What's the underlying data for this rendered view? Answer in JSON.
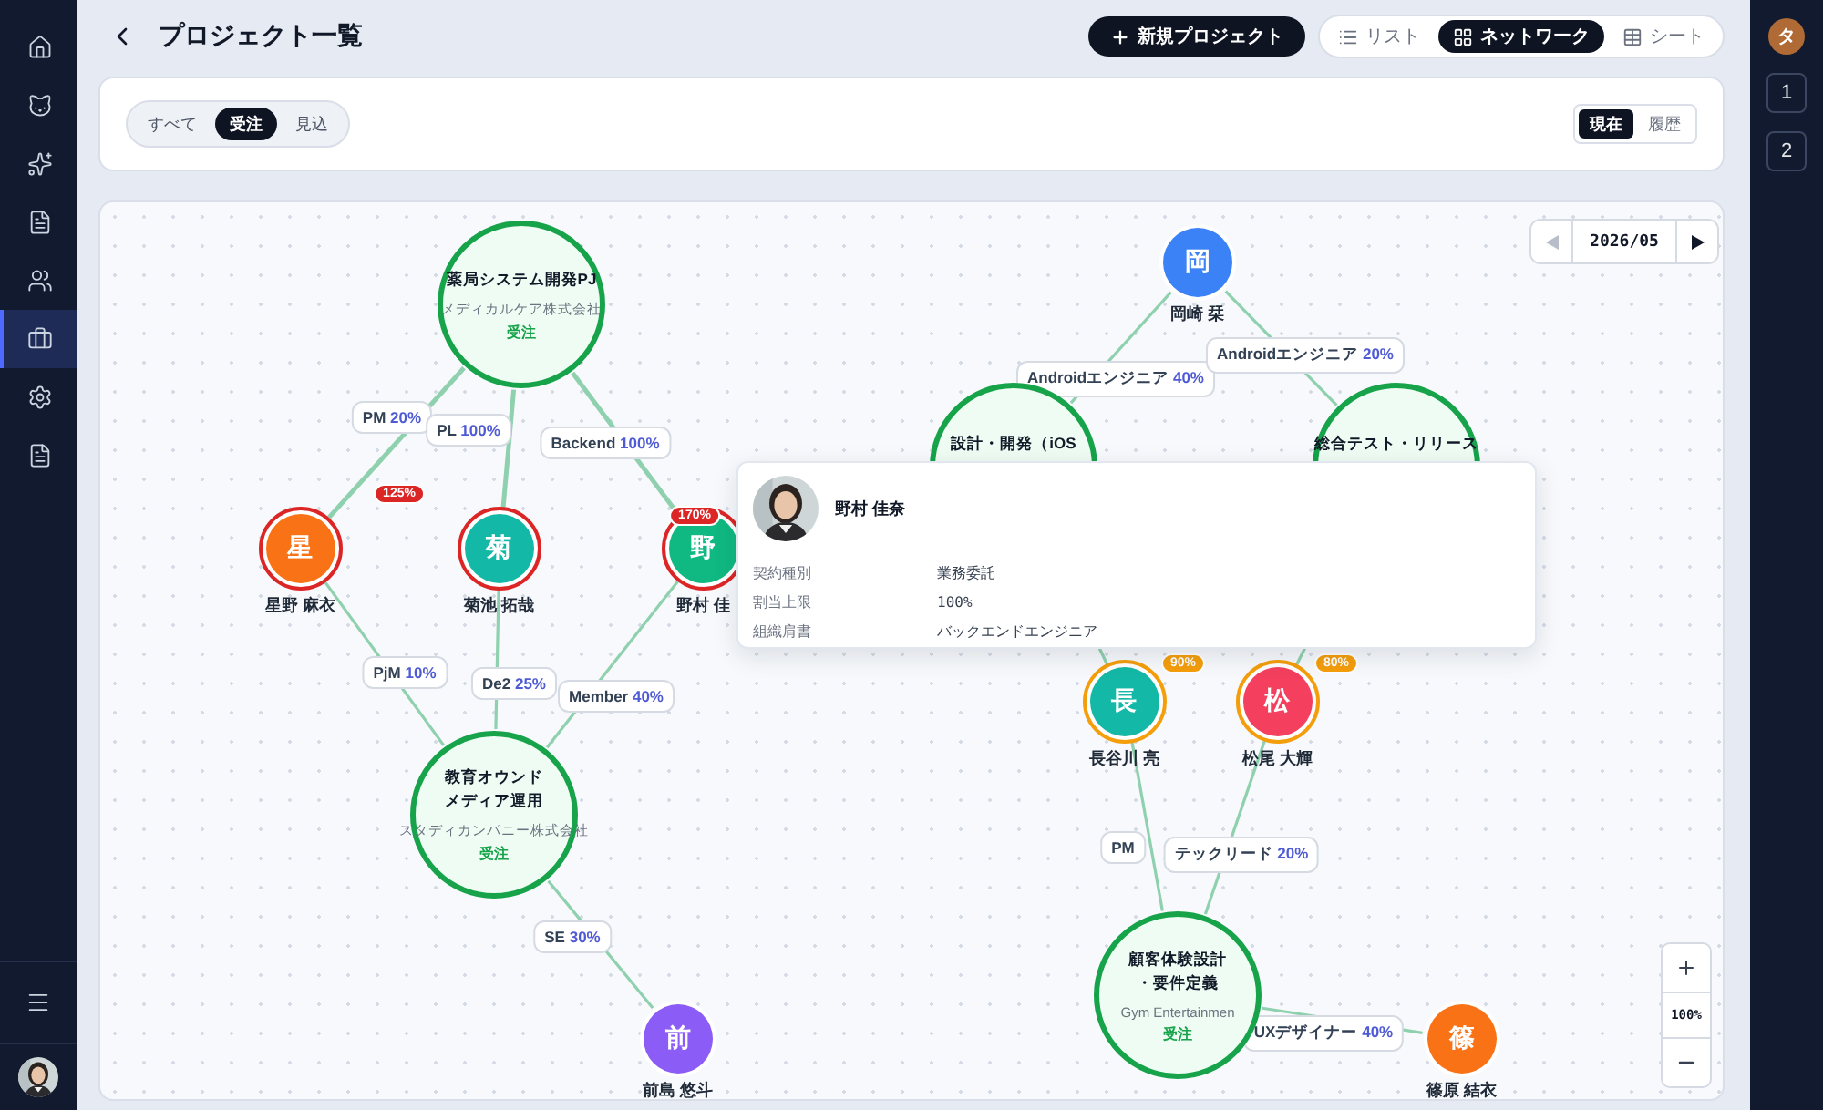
{
  "sidebar": {
    "items": [
      {
        "selected": false
      },
      {
        "selected": false
      },
      {
        "selected": false
      },
      {
        "selected": false
      },
      {
        "selected": false
      },
      {
        "selected": true
      },
      {
        "selected": false
      },
      {
        "selected": false
      }
    ]
  },
  "header": {
    "title": "プロジェクト一覧",
    "new_button": "新規プロジェクト",
    "views": [
      {
        "label": "リスト",
        "selected": false
      },
      {
        "label": "ネットワーク",
        "selected": true
      },
      {
        "label": "シート",
        "selected": false
      }
    ]
  },
  "filters": {
    "status_tabs": [
      {
        "label": "すべて",
        "selected": false
      },
      {
        "label": "受注",
        "selected": true
      },
      {
        "label": "見込",
        "selected": false
      }
    ],
    "time_tabs": [
      {
        "label": "現在",
        "selected": true
      },
      {
        "label": "履歴",
        "selected": false
      }
    ]
  },
  "network": {
    "month": "2026/05",
    "prev_disabled": true,
    "next_disabled": false,
    "projects": [
      {
        "title": [
          "薬局システム開発PJ"
        ],
        "client": "メディカルケア株式会社",
        "status": "受注"
      },
      {
        "title": [
          "設計・開発（iOS"
        ]
      },
      {
        "title": [
          "総合テスト・リリース"
        ]
      },
      {
        "title": [
          "教育オウンド",
          "メディア運用"
        ],
        "client": "スタディカンパニー株式会社",
        "status": "受注"
      },
      {
        "title": [
          "顧客体験設計",
          "・要件定義"
        ],
        "client": "Gym Entertainmen",
        "status": "受注"
      }
    ],
    "members": [
      {
        "initial": "星",
        "name": "星野 麻衣",
        "color": "#f97316",
        "overloaded": true,
        "warning": false,
        "load": "125%"
      },
      {
        "initial": "菊",
        "name": "菊池 拓哉",
        "color": "#14b8a6",
        "overloaded": true,
        "warning": false
      },
      {
        "initial": "野",
        "name": "野村 佳",
        "color": "#10b981",
        "overloaded": true,
        "warning": false,
        "load": "170%"
      },
      {
        "initial": "岡",
        "name": "岡崎 栞",
        "color": "#3b82f6",
        "overloaded": false,
        "warning": false
      },
      {
        "initial": "長",
        "name": "長谷川 亮",
        "color": "#14b8a6",
        "overloaded": false,
        "warning": true,
        "load": "90%"
      },
      {
        "initial": "松",
        "name": "松尾 大輝",
        "color": "#f43f5e",
        "overloaded": false,
        "warning": true,
        "load": "80%"
      },
      {
        "initial": "前",
        "name": "前島 悠斗",
        "color": "#8b5cf6",
        "overloaded": false,
        "warning": false
      },
      {
        "initial": "篠",
        "name": "篠原 結衣",
        "color": "#f97316",
        "overloaded": false,
        "warning": false
      }
    ],
    "assignments": [
      {
        "role": "PM",
        "percent": "20%"
      },
      {
        "role": "PL",
        "percent": "100%"
      },
      {
        "role": "Backend",
        "percent": "100%"
      },
      {
        "role": "Androidエンジニア",
        "percent": "40%"
      },
      {
        "role": "Androidエンジニア",
        "percent": "20%"
      },
      {
        "role": "PjM",
        "percent": "10%"
      },
      {
        "role": "De2",
        "percent": "25%"
      },
      {
        "role": "Member",
        "percent": "40%"
      },
      {
        "role": "SE",
        "percent": "30%"
      },
      {
        "role": "PM"
      },
      {
        "role": "テックリード",
        "percent": "20%"
      },
      {
        "role": "UXデザイナー",
        "percent": "40%"
      }
    ],
    "tooltip": {
      "name": "野村 佳奈",
      "rows": [
        {
          "label": "契約種別",
          "value": "業務委託"
        },
        {
          "label": "割当上限",
          "value": "100%"
        },
        {
          "label": "組織肩書",
          "value": "バックエンドエンジニア"
        }
      ]
    },
    "zoom": "100%"
  },
  "right_rail": {
    "avatar": "タ",
    "items": [
      {
        "label": "1"
      },
      {
        "label": "2"
      }
    ]
  }
}
